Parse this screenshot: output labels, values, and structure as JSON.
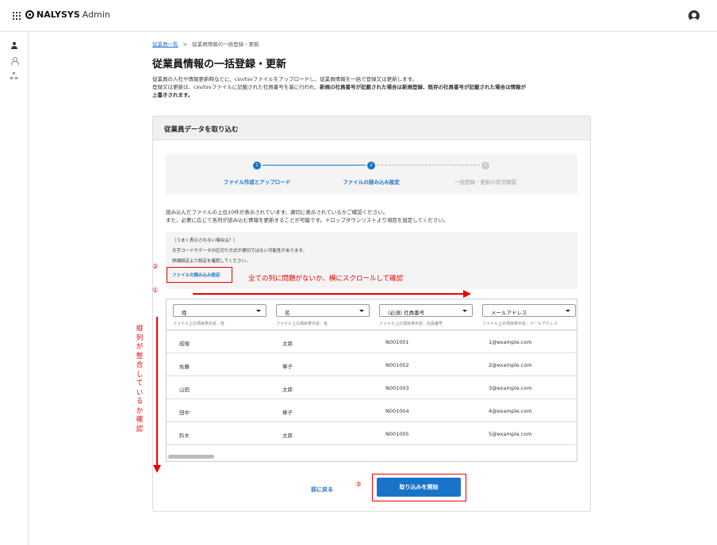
{
  "app": {
    "brand": "NALYSYS",
    "admin": "Admin"
  },
  "breadcrumb": {
    "parent": "従業員一覧",
    "separator": ">",
    "current": "従業員情報の一括登録・更新"
  },
  "page": {
    "title": "従業員情報の一括登録・更新",
    "desc_line1": "従業員の入社や情報更新時などに、csv/tsvファイルをアップロードし、従業員情報を一括で登録又は更新します。",
    "desc_line2a": "登録又は更新は、csv/tsvファイルに記載された社員番号を基に行われ、",
    "desc_line2b": "新規の社員番号が記載された場合は新規登録、既存の社員番号が記載された場合は情報が",
    "desc_line3": "上書きされます。"
  },
  "card": {
    "title": "従業員データを取り込む",
    "steps": [
      {
        "num": "1",
        "label": "ファイル作成とアップロード"
      },
      {
        "num": "2",
        "label": "ファイルの読み込み設定"
      },
      {
        "num": "3",
        "label": "一括登録・更新の状況確認"
      }
    ],
    "info_line1": "読み込んだファイルの上位10件が表示されています。適切に表示されているかご確認ください。",
    "info_line2": "また、必要に応じて各列が読み込む情報を更新することが可能です。ドロップダウンリストより項目を設定してください。",
    "hint_title": "（うまく表示されない場合は？）",
    "hint_line1": "文字コードやデータの区切り方式が適切ではない可能性があります。",
    "hint_line2": "詳細設定より設定を確認してください。",
    "hint_link": "ファイルの読み込み設定",
    "columns": [
      {
        "label": "姓",
        "sub": "ファイル上の項目表示名：姓"
      },
      {
        "label": "名",
        "sub": "ファイル上の項目表示名：名"
      },
      {
        "label": "(必須) 社員番号",
        "sub": "ファイル上の項目表示名：社員番号"
      },
      {
        "label": "メールアドレス",
        "sub": "ファイル上の項目表示名：メールアドレス"
      }
    ],
    "rows": [
      [
        "成瑆",
        "太郎",
        "N001001",
        "1@example.com"
      ],
      [
        "佐藤",
        "華子",
        "N001002",
        "2@example.com"
      ],
      [
        "山田",
        "太郎",
        "N001003",
        "3@example.com"
      ],
      [
        "田中",
        "華子",
        "N001004",
        "4@example.com"
      ],
      [
        "鈴木",
        "太郎",
        "N001005",
        "5@example.com"
      ]
    ],
    "back_label": "前に戻る",
    "start_label": "取り込みを開始"
  },
  "annotations": {
    "num1": "①",
    "num2": "②",
    "num3": "③",
    "horizontal_note": "全ての列に問題がないか、横にスクロールして確認",
    "vertical_note": "縦列が整合しているか確認",
    "color": "#e00000"
  },
  "colors": {
    "primary": "#1a73c8",
    "annotation": "#e00000"
  }
}
